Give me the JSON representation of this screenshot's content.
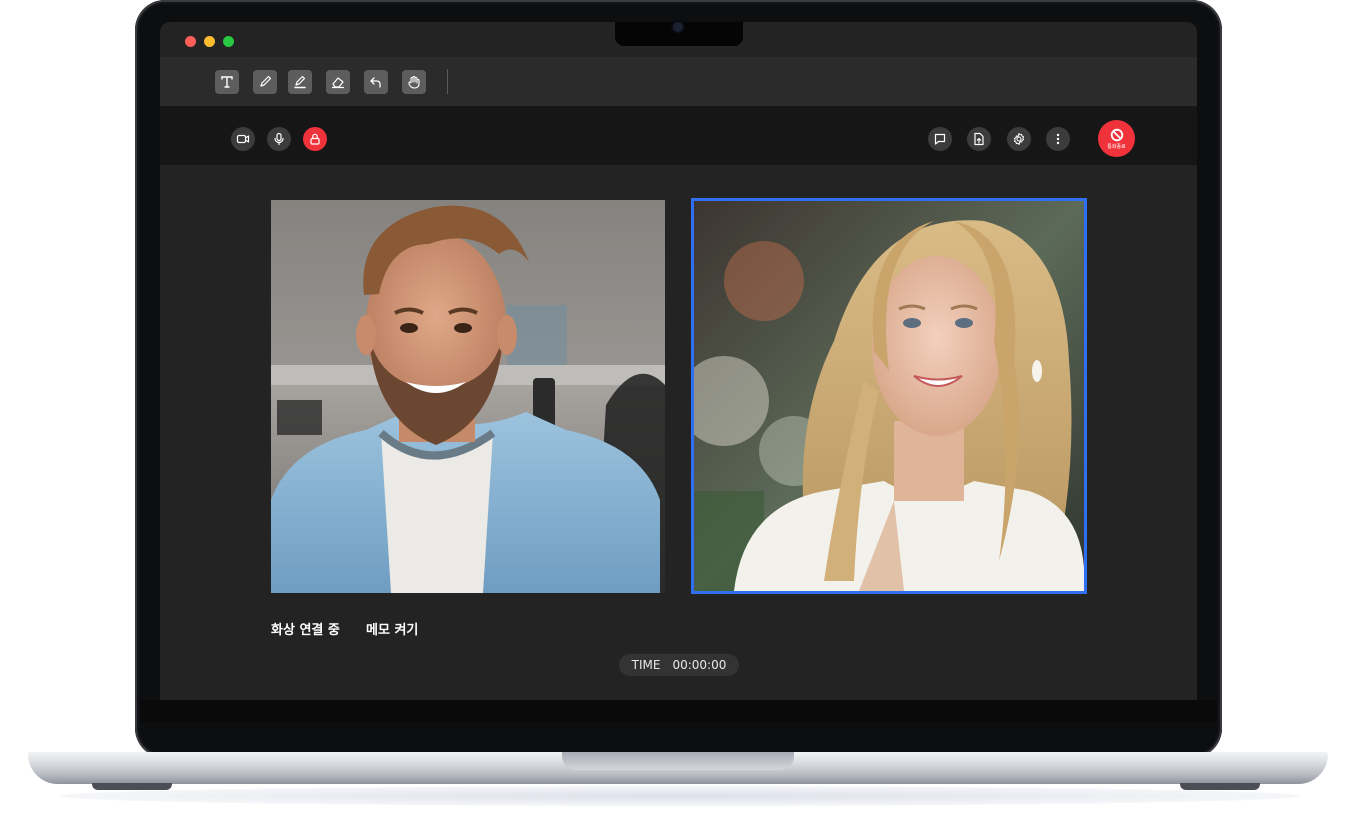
{
  "window_controls": [
    {
      "name": "close",
      "color": "#ff5f57"
    },
    {
      "name": "minimize",
      "color": "#febc2e"
    },
    {
      "name": "zoom",
      "color": "#28c840"
    }
  ],
  "drawing_tools": [
    {
      "name": "text-tool",
      "icon": "text-icon"
    },
    {
      "name": "pen-tool",
      "icon": "pen-icon"
    },
    {
      "name": "highlighter-tool",
      "icon": "highlighter-icon"
    },
    {
      "name": "eraser-tool",
      "icon": "eraser-icon"
    },
    {
      "name": "undo-tool",
      "icon": "undo-icon"
    },
    {
      "name": "hand-tool",
      "icon": "hand-icon"
    }
  ],
  "call_controls_left": [
    {
      "name": "camera-toggle",
      "icon": "video-camera-icon"
    },
    {
      "name": "mic-toggle",
      "icon": "microphone-icon"
    },
    {
      "name": "lock-toggle",
      "icon": "lock-icon",
      "color": "#f0333b"
    }
  ],
  "call_controls_right": [
    {
      "name": "chat",
      "icon": "chat-bubble-icon"
    },
    {
      "name": "share-file",
      "icon": "file-upload-icon"
    },
    {
      "name": "settings",
      "icon": "gear-icon"
    },
    {
      "name": "more",
      "icon": "more-vertical-icon"
    }
  ],
  "end_call": {
    "label": "통화종료",
    "icon": "prohibited-icon",
    "color": "#f0333b"
  },
  "participants": [
    {
      "name": "participant-left",
      "description": "smiling bearded man in denim shirt",
      "active": false
    },
    {
      "name": "participant-right",
      "description": "smiling woman with long wavy blonde hair",
      "active": true,
      "highlight_color": "#2f6ff2"
    }
  ],
  "status": {
    "connection_label": "화상 연결 중",
    "memo_label": "메모 켜기"
  },
  "timer": {
    "label": "TIME",
    "value": "00:00:00"
  }
}
